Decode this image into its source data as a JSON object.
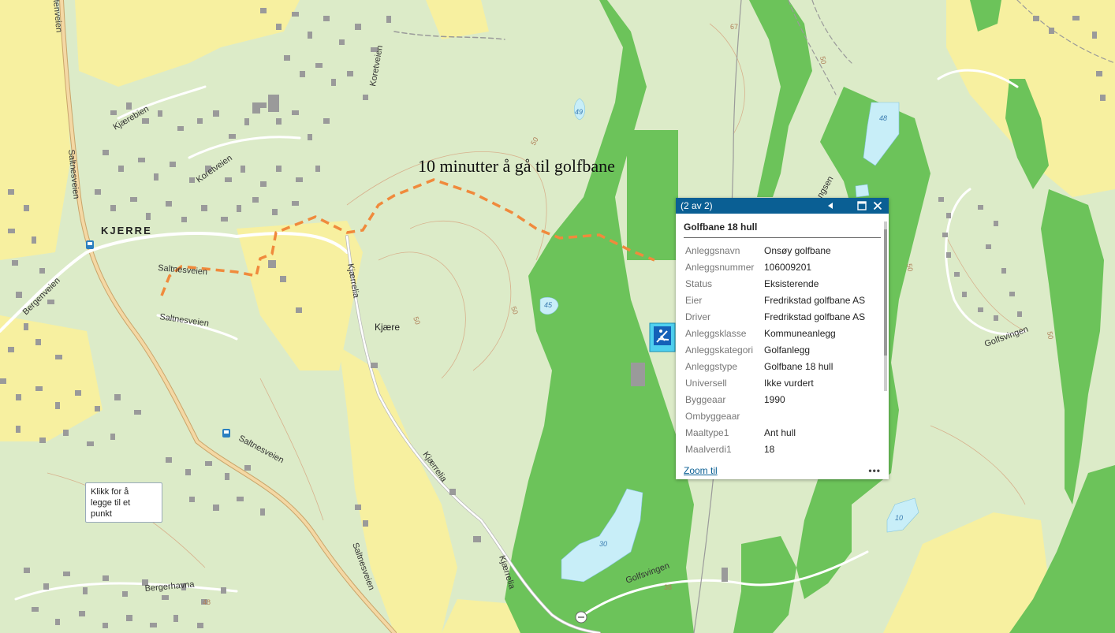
{
  "map": {
    "route_label": "10 minutter å gå til golfbane",
    "place_labels": {
      "kjerre": "KJERRE",
      "kjaere": "Kjære"
    },
    "road_labels": {
      "kjaerrelia_1": "Kjærrelia",
      "kjaerrelia_2": "Kjærrelia",
      "kjaerrelia_3": "Kjærrelia",
      "saltnesveien_1": "Saltnesveien",
      "saltnesveien_2": "Saltnesveien",
      "saltnesveien_3": "Saltnesveien",
      "saltnesveien_4": "Saltnesveien",
      "saltnesveien_5": "Saltnesveien",
      "koretveien_1": "Koretveien",
      "koretveien_2": "Koretveien",
      "kjaerebien": "Kjærebien",
      "bergenveien": "Bergenveien",
      "bergerhavna": "Bergerhavna",
      "golfsvingen_1": "Golfsvingen",
      "golfsvingen_2": "Golfsvingen",
      "tenveien": "tenveien",
      "ngsen": "ngsen"
    },
    "lake_labels": {
      "l49": "49",
      "l48": "48",
      "l45": "45",
      "l30": "30",
      "l10": "10"
    },
    "contour_labels": {
      "c67": "67",
      "c50a": "50",
      "c50b": "50",
      "c50c": "50",
      "c50d": "50",
      "c50e": "50",
      "c50f": "50",
      "c38": "38",
      "c48": "48"
    },
    "colors": {
      "forest": "#6cc35a",
      "open_land": "#dcebc8",
      "field": "#f7f0a0",
      "water": "#c8eef8",
      "route": "#f08a3c",
      "building": "#9a9a9a",
      "popup_header": "#0a5f94"
    }
  },
  "popup": {
    "counter": "(2 av 2)",
    "title": "Golfbane 18 hull",
    "rows": [
      {
        "key": "Anleggsnavn",
        "value": "Onsøy golfbane"
      },
      {
        "key": "Anleggsnummer",
        "value": "106009201"
      },
      {
        "key": "Status",
        "value": "Eksisterende"
      },
      {
        "key": "Eier",
        "value": "Fredrikstad golfbane AS"
      },
      {
        "key": "Driver",
        "value": "Fredrikstad golfbane AS"
      },
      {
        "key": "Anleggsklasse",
        "value": "Kommuneanlegg"
      },
      {
        "key": "Anleggskategori",
        "value": "Golfanlegg"
      },
      {
        "key": "Anleggstype",
        "value": "Golfbane 18 hull"
      },
      {
        "key": "Universell",
        "value": "Ikke vurdert"
      },
      {
        "key": "Byggeaar",
        "value": "1990"
      },
      {
        "key": "Ombyggeaar",
        "value": ""
      },
      {
        "key": "Maaltype1",
        "value": "Ant hull"
      },
      {
        "key": "Maalverdi1",
        "value": "18"
      }
    ],
    "zoom_label": "Zoom til",
    "more_label": "•••",
    "icons": {
      "prev": "triangle-left-icon",
      "maximize": "maximize-icon",
      "close": "close-icon",
      "facility": "golf-facility-icon"
    }
  },
  "tooltip": {
    "lines": [
      "Klikk for å",
      "legge til et",
      "punkt"
    ]
  }
}
